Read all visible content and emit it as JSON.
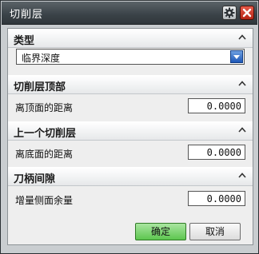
{
  "window": {
    "title": "切削层",
    "title_icons": [
      "gear-icon",
      "close-icon"
    ]
  },
  "sections": {
    "type": {
      "header": "类型",
      "select_value": "临界深度"
    },
    "top": {
      "header": "切削层顶部",
      "field_label": "离顶面的距离",
      "field_value": "0.0000"
    },
    "prev": {
      "header": "上一个切削层",
      "field_label": "离底面的距离",
      "field_value": "0.0000"
    },
    "clearance": {
      "header": "刀柄间隙",
      "field_label": "增量侧面余量",
      "field_value": "0.0000"
    }
  },
  "buttons": {
    "ok": "确定",
    "cancel": "取消"
  },
  "colors": {
    "ok_button": "#5dc64f",
    "close_button": "#c23020",
    "dropdown_button": "#2a63c4"
  }
}
